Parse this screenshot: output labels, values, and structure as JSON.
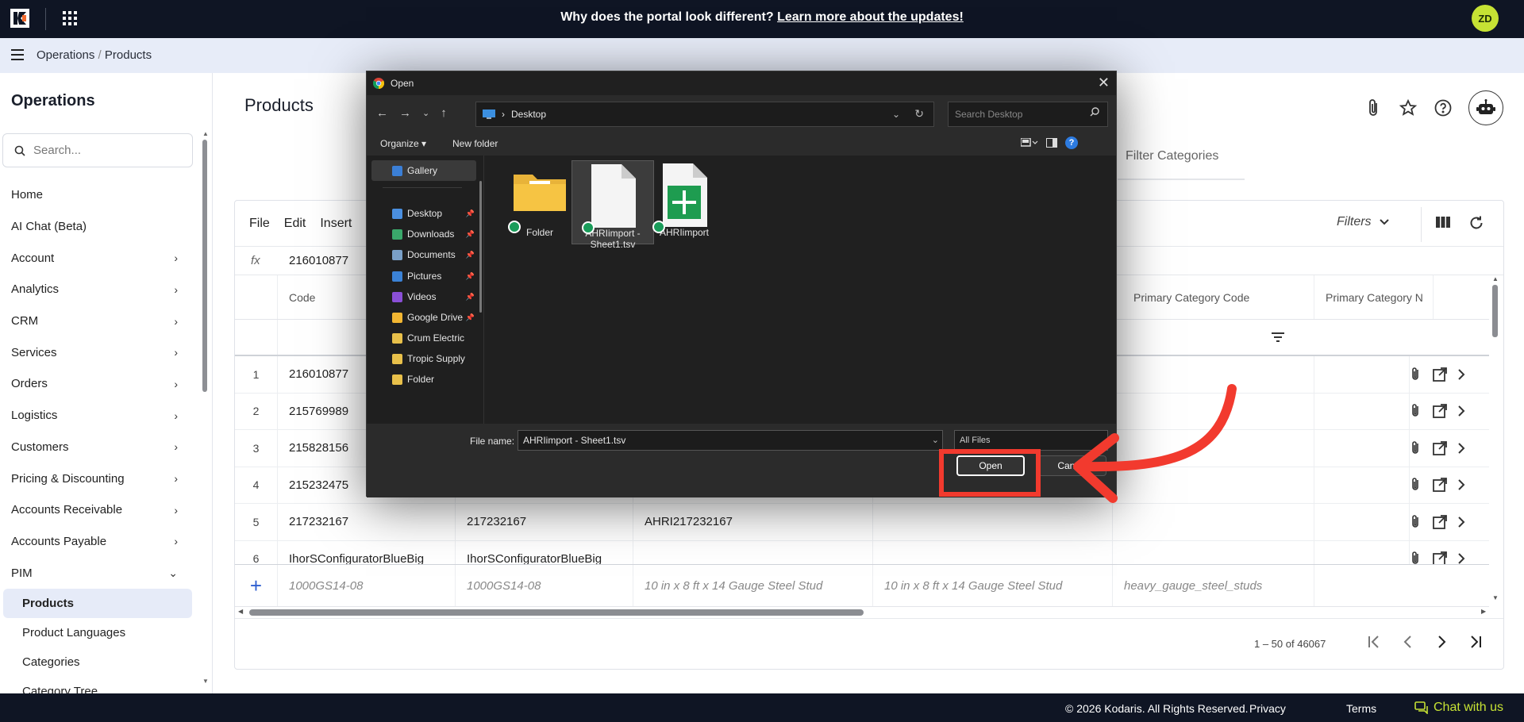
{
  "banner": {
    "question": "Why does the portal look different?",
    "link": "Learn more about the updates!"
  },
  "user": {
    "initials": "ZD"
  },
  "breadcrumb": {
    "section": "Operations",
    "sep": "/",
    "page": "Products"
  },
  "sidebar": {
    "title": "Operations",
    "search_placeholder": "Search...",
    "items": [
      {
        "label": "Home",
        "chev": ""
      },
      {
        "label": "AI Chat (Beta)",
        "chev": ""
      },
      {
        "label": "Account",
        "chev": "›"
      },
      {
        "label": "Analytics",
        "chev": "›"
      },
      {
        "label": "CRM",
        "chev": "›"
      },
      {
        "label": "Services",
        "chev": "›"
      },
      {
        "label": "Orders",
        "chev": "›"
      },
      {
        "label": "Logistics",
        "chev": "›"
      },
      {
        "label": "Customers",
        "chev": "›"
      },
      {
        "label": "Pricing & Discounting",
        "chev": "›"
      },
      {
        "label": "Accounts Receivable",
        "chev": "›"
      },
      {
        "label": "Accounts Payable",
        "chev": "›"
      },
      {
        "label": "PIM",
        "chev": "⌄"
      }
    ],
    "sub_items": [
      "Products",
      "Product Languages",
      "Categories",
      "Category Tree"
    ]
  },
  "main": {
    "title": "Products",
    "filter_categories": "Filter Categories"
  },
  "grid": {
    "menu": [
      "File",
      "Edit",
      "Insert"
    ],
    "filters_label": "Filters",
    "fx_label": "fx",
    "fx_value": "216010877",
    "headers": [
      "Code",
      "Primary Category Code",
      "Primary Category N"
    ],
    "rows": [
      {
        "n": "1",
        "code": "216010877",
        "c2": "",
        "c3": ""
      },
      {
        "n": "2",
        "code": "215769989",
        "c2": "",
        "c3": ""
      },
      {
        "n": "3",
        "code": "215828156",
        "c2": "",
        "c3": ""
      },
      {
        "n": "4",
        "code": "215232475",
        "c2": "",
        "c3": ""
      },
      {
        "n": "5",
        "code": "217232167",
        "c2": "217232167",
        "c3": "AHRI217232167"
      },
      {
        "n": "6",
        "code": "IhorSConfiguratorBlueBig",
        "c2": "IhorSConfiguratorBlueBig",
        "c3": ""
      }
    ],
    "new_row": {
      "plus": "+",
      "code": "1000GS14-08",
      "c2": "1000GS14-08",
      "c3": "10 in x 8 ft x 14 Gauge Steel Stud",
      "c4": "10 in x 8 ft x 14 Gauge Steel Stud",
      "c5": "heavy_gauge_steel_studs"
    },
    "pager": "1 – 50 of 46067"
  },
  "footer": {
    "copyright": "© 2026 Kodaris. All Rights Reserved.",
    "privacy": "Privacy",
    "terms": "Terms",
    "chat": "Chat with us"
  },
  "dialog": {
    "title": "Open",
    "path": "Desktop",
    "search_placeholder": "Search Desktop",
    "organize": "Organize ▾",
    "new_folder": "New folder",
    "nav": [
      {
        "label": "Gallery",
        "color": "#3b7fd6",
        "pinned": false
      },
      {
        "label": "Desktop",
        "color": "#4a8fe0",
        "pinned": true
      },
      {
        "label": "Downloads",
        "color": "#3aa86b",
        "pinned": true
      },
      {
        "label": "Documents",
        "color": "#7aa0c8",
        "pinned": true
      },
      {
        "label": "Pictures",
        "color": "#3b82d6",
        "pinned": true
      },
      {
        "label": "Videos",
        "color": "#8a4fd6",
        "pinned": true
      },
      {
        "label": "Google Drive",
        "color": "#f2b632",
        "pinned": true
      },
      {
        "label": "Crum Electric",
        "color": "#e8c04a",
        "pinned": false
      },
      {
        "label": "Tropic Supply",
        "color": "#e8c04a",
        "pinned": false
      },
      {
        "label": "Folder",
        "color": "#e8c04a",
        "pinned": false
      }
    ],
    "files": [
      {
        "name": "Folder",
        "kind": "folder"
      },
      {
        "name": "AHRIimport - Sheet1.tsv",
        "kind": "tsv"
      },
      {
        "name": "AHRIimport",
        "kind": "sheet"
      }
    ],
    "filename_label": "File name:",
    "filename_value": "AHRIimport - Sheet1.tsv",
    "filetype": "All Files",
    "open_button": "Open",
    "cancel_button": "Cancel"
  },
  "colors": {
    "banner_bg": "#0f1524",
    "accent_lime": "#c6e234",
    "highlight_red": "#f23a2e",
    "dialog_bg": "#202020"
  }
}
